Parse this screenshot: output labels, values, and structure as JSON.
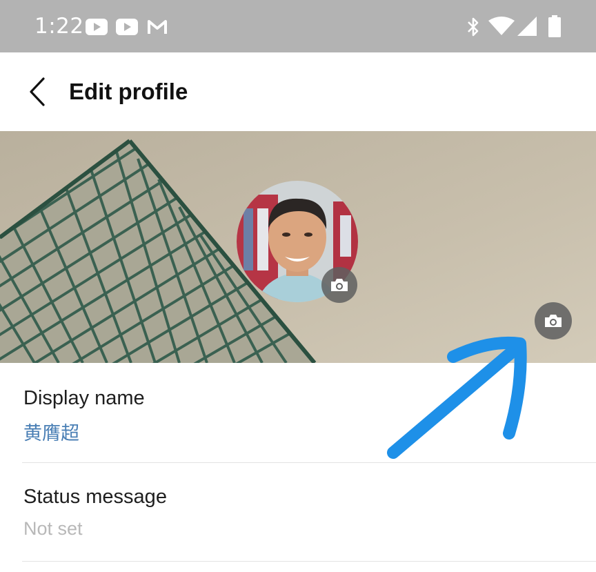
{
  "status_bar": {
    "time": "1:22",
    "notification_icons": [
      "youtube-icon",
      "youtube-icon",
      "gmail-icon"
    ],
    "system_icons": [
      "bluetooth-icon",
      "wifi-icon",
      "signal-icon",
      "battery-icon"
    ]
  },
  "header": {
    "back_icon": "chevron-left-icon",
    "title": "Edit profile"
  },
  "profile": {
    "cover_camera_icon": "camera-icon",
    "avatar_camera_icon": "camera-icon"
  },
  "fields": [
    {
      "label": "Display name",
      "value": "黄膺超",
      "value_color": "#4a7fb5"
    },
    {
      "label": "Status message",
      "value": "Not set",
      "value_color": "#b8b8b8"
    }
  ],
  "annotation": {
    "arrow_color": "#1e90e8"
  }
}
